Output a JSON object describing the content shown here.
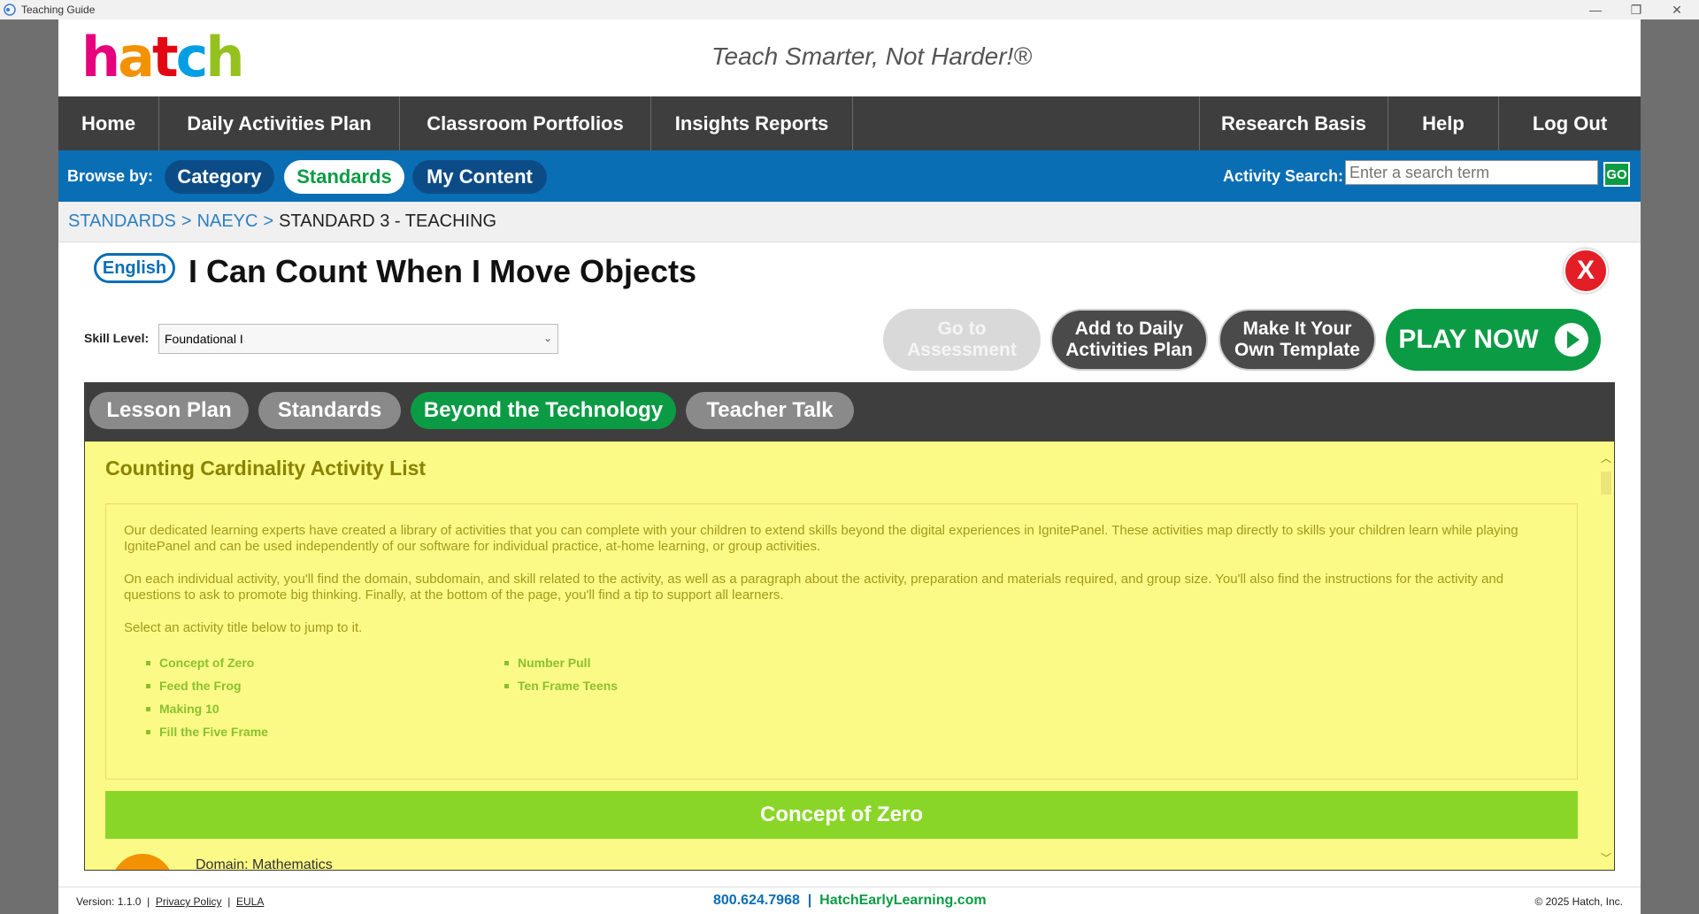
{
  "window": {
    "title": "Teaching Guide",
    "minimize": "—",
    "restore": "❐",
    "close": "✕"
  },
  "header": {
    "logo_letters": [
      "h",
      "a",
      "t",
      "c",
      "h"
    ],
    "tagline": "Teach Smarter, Not Harder!®"
  },
  "nav": {
    "items": [
      {
        "label": "Home"
      },
      {
        "label": "Daily Activities Plan"
      },
      {
        "label": "Classroom Portfolios"
      },
      {
        "label": "Insights Reports"
      },
      {
        "label": ""
      },
      {
        "label": "Research Basis"
      },
      {
        "label": "Help"
      },
      {
        "label": "Log Out"
      }
    ]
  },
  "browse": {
    "label": "Browse by:",
    "options": [
      {
        "label": "Category"
      },
      {
        "label": "Standards"
      },
      {
        "label": "My Content"
      }
    ],
    "active": "Standards",
    "search_label": "Activity Search:",
    "search_placeholder": "Enter a search term",
    "go_label": "GO"
  },
  "breadcrumb": {
    "items": [
      "STANDARDS",
      "NAEYC",
      "STANDARD 3 - TEACHING"
    ],
    "separator": ">"
  },
  "activity": {
    "language": "English",
    "title": "I Can Count When I Move Objects",
    "close_label": "X",
    "skill_label": "Skill Level:",
    "skill_value": "Foundational I"
  },
  "actions": {
    "go_to_assessment": [
      "Go to",
      "Assessment"
    ],
    "add_daily": [
      "Add to Daily",
      "Activities Plan"
    ],
    "make_template": [
      "Make It Your",
      "Own Template"
    ],
    "play_now": "PLAY NOW"
  },
  "tabs": {
    "items": [
      {
        "label": "Lesson Plan"
      },
      {
        "label": "Standards"
      },
      {
        "label": "Beyond the Technology"
      },
      {
        "label": "Teacher Talk"
      }
    ],
    "active": "Beyond the Technology"
  },
  "content": {
    "heading": "Counting Cardinality Activity List",
    "para1": "Our dedicated learning experts have created a library of activities that you can complete with your children to extend skills beyond the digital experiences in IgnitePanel. These activities map directly to skills your children learn while playing IgnitePanel and can be used independently of our software for individual practice, at-home learning, or group activities.",
    "para2": "On each individual activity, you'll find the domain, subdomain, and skill related to the activity, as well as a paragraph about the activity, preparation and materials required, and group size. You'll also find the instructions for the activity and questions to ask to promote big thinking. Finally, at the bottom of the page, you'll find a tip to support all learners.",
    "para3": "Select an activity title below to jump to it.",
    "links_col1": [
      "Concept of Zero",
      "Feed the Frog",
      "Making 10",
      "Fill the Five Frame"
    ],
    "links_col2": [
      "Number Pull",
      "Ten Frame Teens"
    ],
    "section_title": "Concept of Zero",
    "domain_peek": "Domain:   Mathematics"
  },
  "footer": {
    "version": "Version: 1.1.0",
    "privacy": "Privacy Policy",
    "eula": "EULA",
    "phone": "800.624.7968",
    "divider": "|",
    "site": "HatchEarlyLearning.com",
    "copyright": "© 2025 Hatch, Inc."
  },
  "colors": {
    "brand_green": "#0c9b45",
    "brand_blue": "#0a6eb5",
    "nav_dark": "#3e3e3e",
    "content_yellow": "#fcfa87",
    "section_green": "#8ad628",
    "close_red": "#e41e26"
  }
}
